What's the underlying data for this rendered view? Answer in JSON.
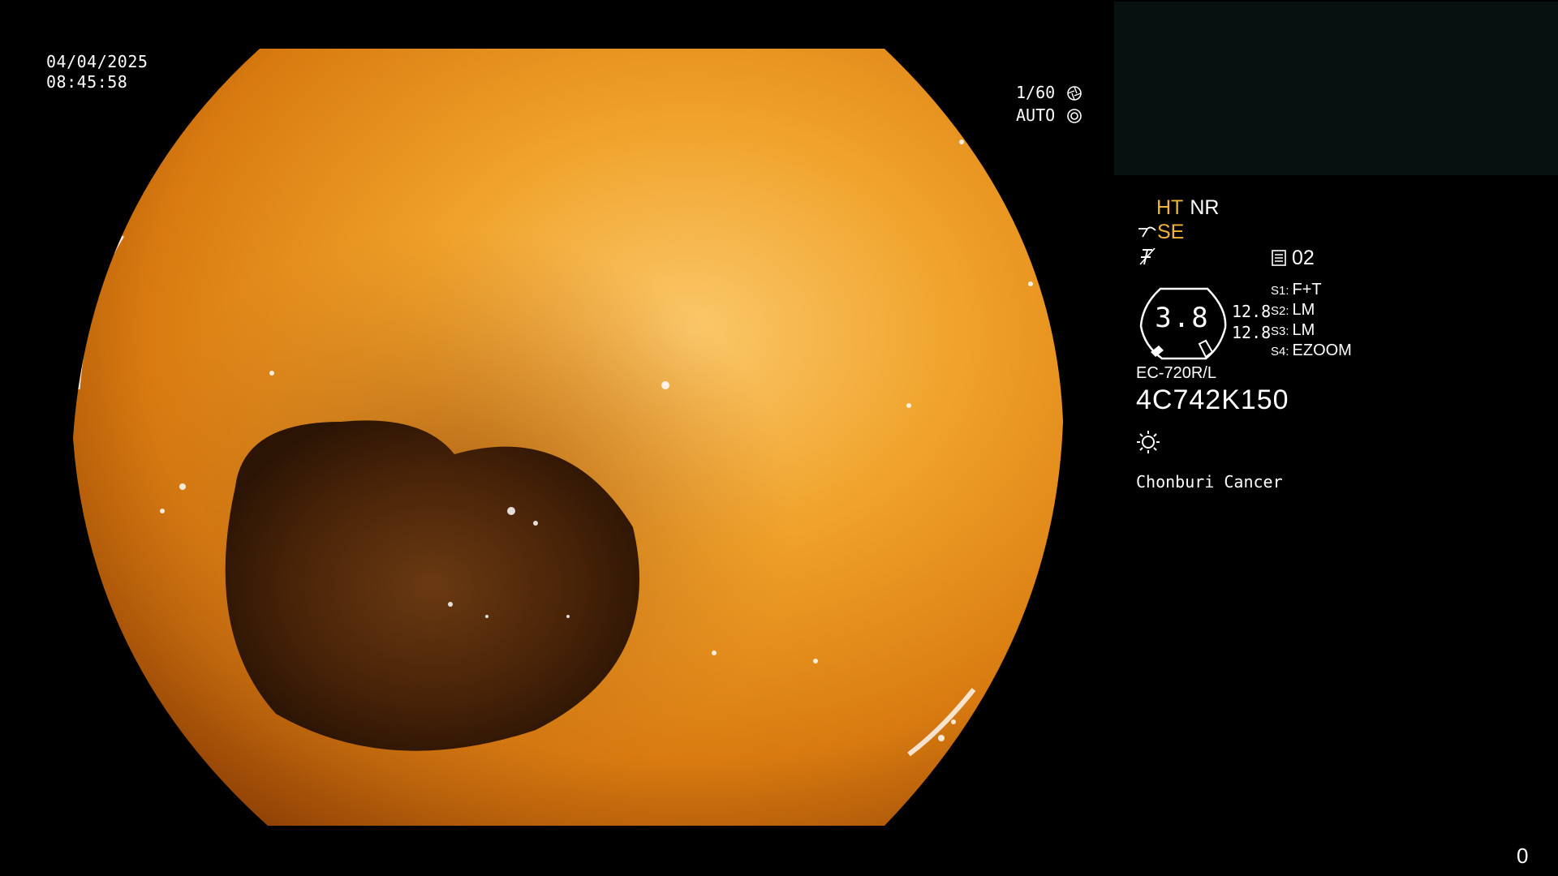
{
  "overlay": {
    "date": "04/04/2025",
    "time": "08:45:58",
    "shutter": "1/60",
    "iris": "AUTO",
    "shutter_icon": "aperture-icon",
    "iris_icon": "iris-icon"
  },
  "panel": {
    "ht_label": "HT",
    "nr_label": "NR",
    "se_label": "SE",
    "sequence_number": "02",
    "gauge_value": "3.8",
    "gauge_side_1": "12.8",
    "gauge_side_2": "12.8",
    "slots": [
      {
        "key": "S1:",
        "value": "F+T"
      },
      {
        "key": "S2:",
        "value": "LM"
      },
      {
        "key": "S3:",
        "value": "LM"
      },
      {
        "key": "S4:",
        "value": "EZOOM"
      }
    ],
    "model": "EC-720R/L",
    "serial": "4C742K150",
    "institution": "Chonburi Cancer"
  },
  "frame_counter": "0",
  "colors": {
    "accent": "#f0b43a",
    "thumb_bg": "#061110",
    "mucosa": "#e58a16"
  }
}
